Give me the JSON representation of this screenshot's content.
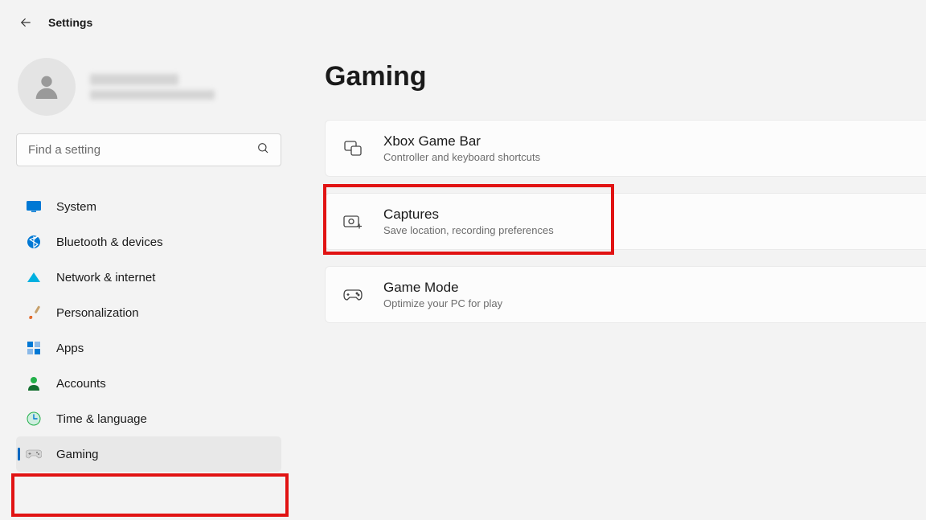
{
  "app_title": "Settings",
  "search_placeholder": "Find a setting",
  "nav": [
    {
      "label": "System"
    },
    {
      "label": "Bluetooth & devices"
    },
    {
      "label": "Network & internet"
    },
    {
      "label": "Personalization"
    },
    {
      "label": "Apps"
    },
    {
      "label": "Accounts"
    },
    {
      "label": "Time & language"
    },
    {
      "label": "Gaming"
    }
  ],
  "page_title": "Gaming",
  "cards": [
    {
      "title": "Xbox Game Bar",
      "sub": "Controller and keyboard shortcuts"
    },
    {
      "title": "Captures",
      "sub": "Save location, recording preferences"
    },
    {
      "title": "Game Mode",
      "sub": "Optimize your PC for play"
    }
  ]
}
